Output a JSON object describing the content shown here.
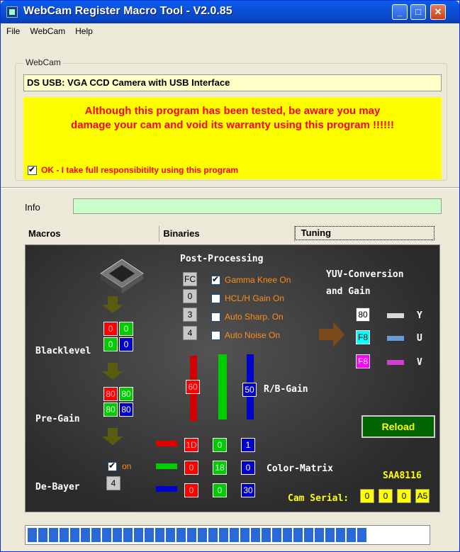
{
  "window": {
    "title": "WebCam Register Macro Tool - V2.0.85"
  },
  "titlebar_buttons": {
    "minimize": "_",
    "maximize": "□",
    "close": "✕"
  },
  "menu": [
    "File",
    "WebCam",
    "Help"
  ],
  "webcam_group": {
    "label": "WebCam",
    "camera_name": "DS USB: VGA CCD Camera with USB Interface",
    "warning": "Although this program has been tested, be aware you may\ndamage your cam and void its warranty using this program !!!!!!",
    "ok_label": "OK - I take full responsibitilty using this program",
    "ok_checked": true
  },
  "info": {
    "label": "Info",
    "value": ""
  },
  "tabs": [
    {
      "label": "Macros"
    },
    {
      "label": "Binaries"
    },
    {
      "label": "Tuning",
      "active": true
    }
  ],
  "tuning": {
    "post_processing": {
      "title": "Post-Processing",
      "values": [
        "FC",
        "0",
        "3",
        "4"
      ],
      "options": [
        {
          "label": "Gamma Knee On",
          "checked": true
        },
        {
          "label": "HCL/H Gain On",
          "checked": false
        },
        {
          "label": "Auto Sharp. On",
          "checked": false
        },
        {
          "label": "Auto Noise On",
          "checked": false
        }
      ]
    },
    "yuv": {
      "title1": "YUV-Conversion",
      "title2": "and Gain",
      "values": [
        "80",
        "F8",
        "F8"
      ],
      "letters": [
        "Y",
        "U",
        "V"
      ]
    },
    "blacklevel": {
      "label": "Blacklevel",
      "values": [
        "0",
        "0",
        "0",
        "0"
      ]
    },
    "pregain": {
      "label": "Pre-Gain",
      "values": [
        "80",
        "80",
        "80",
        "80"
      ]
    },
    "debayer": {
      "label": "De-Bayer",
      "checked": true,
      "on_label": "on",
      "value": "4"
    },
    "rb_gain": {
      "label": "R/B-Gain",
      "red": "60",
      "blue": "50"
    },
    "color_matrix": {
      "label": "Color-Matrix",
      "rows": [
        [
          "1D",
          "0",
          "1"
        ],
        [
          "0",
          "18",
          "0"
        ],
        [
          "0",
          "0",
          "30"
        ]
      ]
    },
    "reload_label": "Reload",
    "chip_label": "SAA8116",
    "cam_serial": {
      "label": "Cam Serial:",
      "values": [
        "0",
        "0",
        "0",
        "A5"
      ]
    }
  },
  "progress": {
    "segments": 32
  },
  "colors": {
    "accent": "#0a50d8",
    "warning_bg": "#ffff00",
    "warning_text": "#ff0000",
    "info_bg": "#c8ffc8",
    "panel_bg": "#3a3a3a"
  }
}
